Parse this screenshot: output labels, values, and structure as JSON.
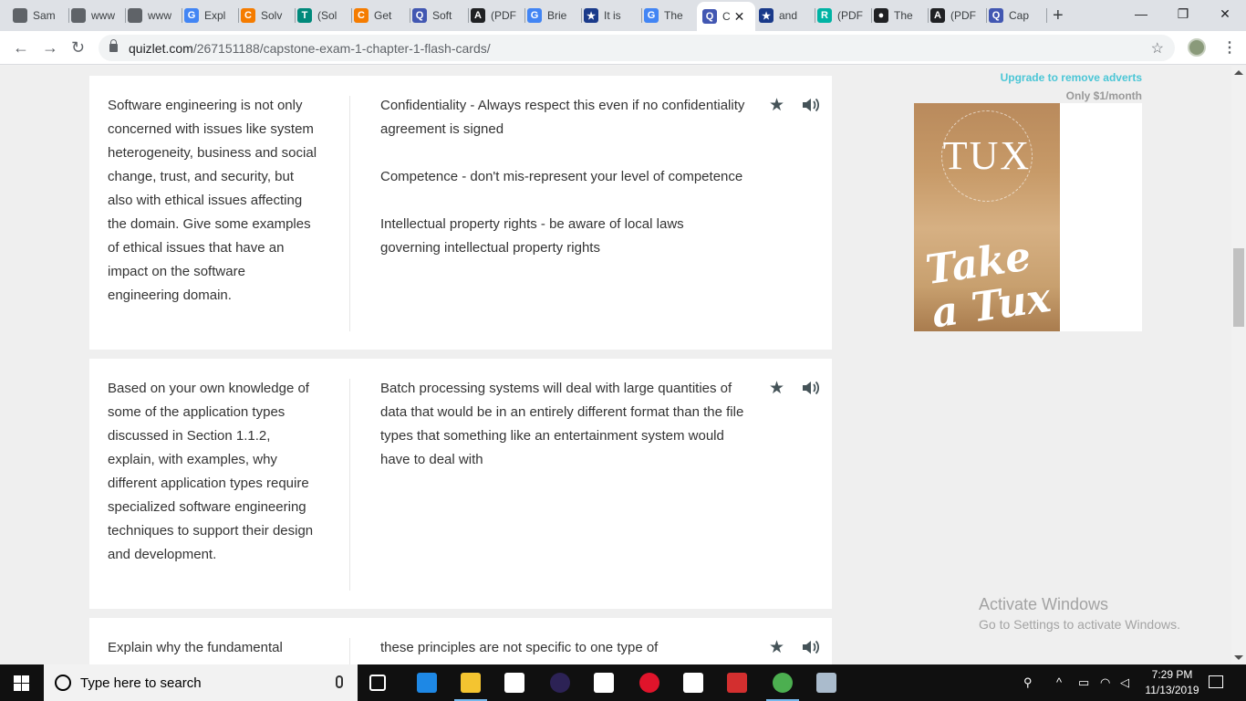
{
  "browser": {
    "tabs": [
      {
        "label": "Sam",
        "fav_color": "#5f6368",
        "fav_char": ""
      },
      {
        "label": "www",
        "fav_color": "#5f6368",
        "fav_char": ""
      },
      {
        "label": "www",
        "fav_color": "#5f6368",
        "fav_char": ""
      },
      {
        "label": "Expl",
        "fav_color": "#4285f4",
        "fav_char": "G"
      },
      {
        "label": "Solv",
        "fav_color": "#f57c00",
        "fav_char": "C"
      },
      {
        "label": "(Sol",
        "fav_color": "#00897b",
        "fav_char": "T"
      },
      {
        "label": "Get",
        "fav_color": "#f57c00",
        "fav_char": "C"
      },
      {
        "label": "Soft",
        "fav_color": "#4257b2",
        "fav_char": "Q"
      },
      {
        "label": "(PDF",
        "fav_color": "#202124",
        "fav_char": "A"
      },
      {
        "label": "Brie",
        "fav_color": "#4285f4",
        "fav_char": "G"
      },
      {
        "label": "It is",
        "fav_color": "#1a3a8a",
        "fav_char": "★"
      },
      {
        "label": "The",
        "fav_color": "#4285f4",
        "fav_char": "G"
      },
      {
        "label": "C",
        "fav_color": "#4257b2",
        "fav_char": "Q"
      },
      {
        "label": "and",
        "fav_color": "#1a3a8a",
        "fav_char": "★"
      },
      {
        "label": "(PDF",
        "fav_color": "#00b3a4",
        "fav_char": "R"
      },
      {
        "label": "The",
        "fav_color": "#202124",
        "fav_char": "●"
      },
      {
        "label": "(PDF",
        "fav_color": "#202124",
        "fav_char": "A"
      },
      {
        "label": "Cap",
        "fav_color": "#4257b2",
        "fav_char": "Q"
      }
    ],
    "active_tab_close": "✕",
    "new_tab": "+",
    "url_domain": "quizlet.com",
    "url_path": "/267151188/capstone-exam-1-chapter-1-flash-cards/",
    "win_minimize": "—",
    "win_restore": "❐",
    "win_close": "✕",
    "back": "←",
    "forward": "→",
    "reload": "↻",
    "bookmark_star": "☆",
    "menu": "⋮"
  },
  "cards": [
    {
      "term": "Software engineering is not only concerned with issues like system heterogeneity, business and social change, trust, and security, but also with ethical issues affecting the domain. Give some examples of ethical issues that have an impact on the software engineering domain.",
      "definition": [
        "Confidentiality - Always respect this even if no confidentiality agreement is signed",
        "Competence - don't mis-represent your level of competence",
        "Intellectual property rights - be aware of local laws governing intellectual property rights"
      ]
    },
    {
      "term": "Based on your own knowledge of some of the application types discussed in Section 1.1.2, explain, with examples, why different application types require specialized software engineering techniques to support their design and development.",
      "definition": [
        "Batch processing systems will deal with large quantities of data that would be in an entirely different format than the file types that something like an entertainment system would have to deal with"
      ]
    },
    {
      "term": "Explain why the fundamental",
      "definition": [
        "these principles are not specific to one type of"
      ]
    }
  ],
  "card_icons": {
    "star": "★"
  },
  "ad": {
    "upgrade": "Upgrade to remove adverts",
    "price": "Only $1/month",
    "brand": "TUX",
    "slogan": "Take a Tux"
  },
  "watermark": {
    "title": "Activate Windows",
    "subtitle": "Go to Settings to activate Windows."
  },
  "taskbar": {
    "search_placeholder": "Type here to search",
    "time": "7:29 PM",
    "date": "11/13/2019",
    "icons": [
      {
        "name": "task-view-icon",
        "color": "#101010"
      },
      {
        "name": "edge-icon",
        "color": "#1e88e5"
      },
      {
        "name": "file-explorer-icon",
        "color": "#f4c430"
      },
      {
        "name": "store-icon",
        "color": "#ffffff"
      },
      {
        "name": "eclipse-icon",
        "color": "#2c2255"
      },
      {
        "name": "mail-icon",
        "color": "#ffffff"
      },
      {
        "name": "opera-icon",
        "color": "#e0142b"
      },
      {
        "name": "notepad-icon",
        "color": "#ffffff"
      },
      {
        "name": "acrobat-icon",
        "color": "#d32f2f"
      },
      {
        "name": "chrome-icon",
        "color": "#4caf50"
      },
      {
        "name": "paint-icon",
        "color": "#aabbcc"
      }
    ]
  }
}
